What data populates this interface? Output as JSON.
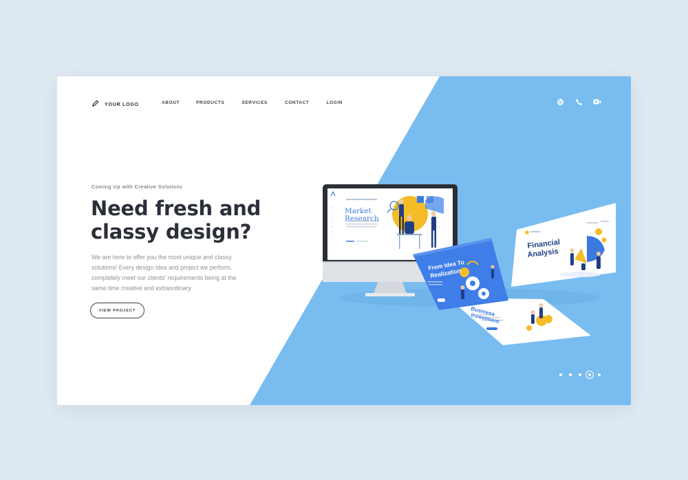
{
  "brand": {
    "logo_text": "YOUR LOGO",
    "logo_icon": "pencil-icon"
  },
  "nav": {
    "items": [
      "ABOUT",
      "PRODUCTS",
      "SERVICES",
      "CONTACT",
      "LOGIN"
    ]
  },
  "social": [
    {
      "icon": "dribbble-icon"
    },
    {
      "icon": "phone-icon"
    },
    {
      "icon": "video-camera-icon"
    }
  ],
  "hero": {
    "eyebrow": "Coming Up with Creative Solutions",
    "headline": "Need fresh and classy design?",
    "description": "We are here to offer you the most unique and classy solutions! Every design idea and project we perform, completely meet our clients' requirements being at the same time creative and extraordinary",
    "cta_label": "VIEW PROJECT"
  },
  "mockups": {
    "monitor_title_line1": "Market",
    "monitor_title_line2": "Research",
    "card1_title_line1": "From Idea To",
    "card1_title_line2": "Realization",
    "card2_title_line1": "Financial",
    "card2_title_line2": "Analysis",
    "card3_title_line1": "Business",
    "card3_title_line2": "Investment"
  },
  "pagination": {
    "count": 5,
    "active_index": 3
  },
  "colors": {
    "accent": "#79bcf0",
    "dark_text": "#2b2f38",
    "muted_text": "#8d929c",
    "page_bg": "#dfe9f1"
  }
}
